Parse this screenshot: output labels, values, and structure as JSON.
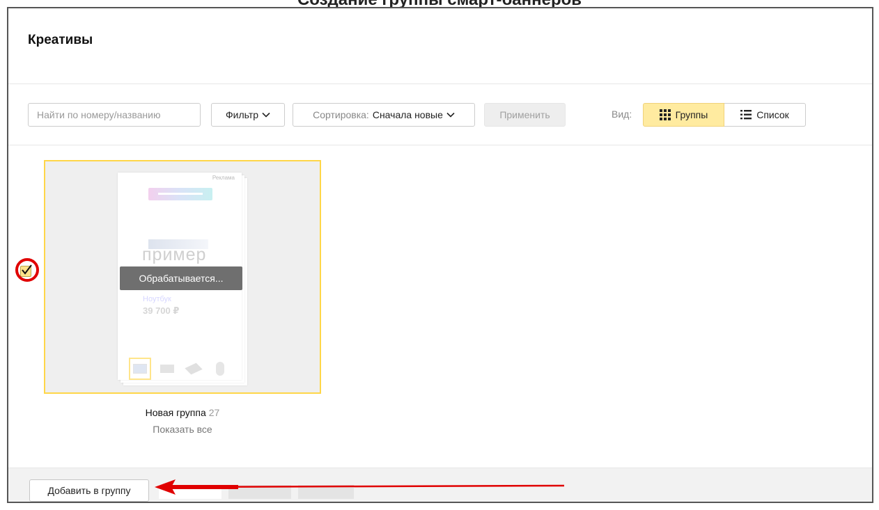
{
  "background": {
    "title": "Создание группы смарт-баннеров"
  },
  "dialog": {
    "title": "Креативы"
  },
  "toolbar": {
    "search_placeholder": "Найти по номеру/названию",
    "filter_label": "Фильтр",
    "sort_prefix": "Сортировка:",
    "sort_value": "Сначала новые",
    "apply_label": "Применить",
    "view_label": "Вид:",
    "view_groups_label": "Группы",
    "view_list_label": "Список",
    "active_view": "groups"
  },
  "group_card": {
    "status": "Обрабатывается...",
    "name": "Новая группа",
    "count": "27",
    "show_all": "Показать все",
    "selected": true,
    "preview": {
      "ad_label": "Реклама",
      "word": "пример",
      "product": "Ноутбук",
      "price": "39 700 ₽"
    }
  },
  "footer": {
    "add_to_group_label": "Добавить в группу"
  },
  "colors": {
    "accent_yellow": "#ffd648",
    "annotation_red": "#e00000",
    "toggle_active": "#ffeba0"
  },
  "icons": {
    "filter": "chevron-down-icon",
    "groups": "grid-icon",
    "list": "list-icon",
    "checkbox": "checkmark-icon"
  }
}
